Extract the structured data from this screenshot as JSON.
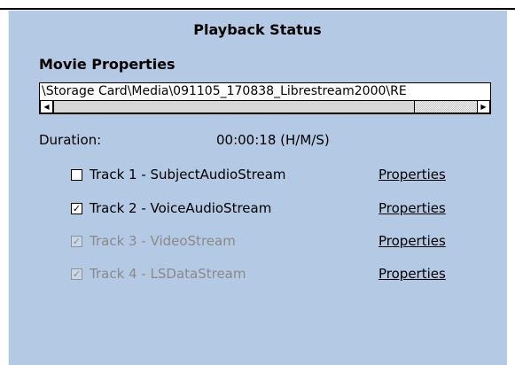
{
  "dialog": {
    "title": "Playback Status"
  },
  "movie": {
    "section_title": "Movie Properties",
    "path": "\\Storage Card\\Media\\091105_170838_Librestream2000\\RE",
    "scroll": {
      "left_arrow": "◀",
      "right_arrow": "▶",
      "position_fraction": 0.0
    }
  },
  "duration": {
    "label": "Duration:",
    "value": "00:00:18 (H/M/S)"
  },
  "tracks": [
    {
      "label": "Track 1 - SubjectAudioStream",
      "checked": false,
      "enabled": true,
      "check_glyph": "",
      "link": "Properties"
    },
    {
      "label": "Track 2 - VoiceAudioStream",
      "checked": true,
      "enabled": true,
      "check_glyph": "✓",
      "link": "Properties"
    },
    {
      "label": "Track 3 - VideoStream",
      "checked": true,
      "enabled": false,
      "check_glyph": "✓",
      "link": "Properties"
    },
    {
      "label": "Track 4 - LSDataStream",
      "checked": true,
      "enabled": false,
      "check_glyph": "✓",
      "link": "Properties"
    }
  ],
  "colors": {
    "panel_background": "#b4c9e3",
    "disabled_text": "#8a8a8a"
  }
}
